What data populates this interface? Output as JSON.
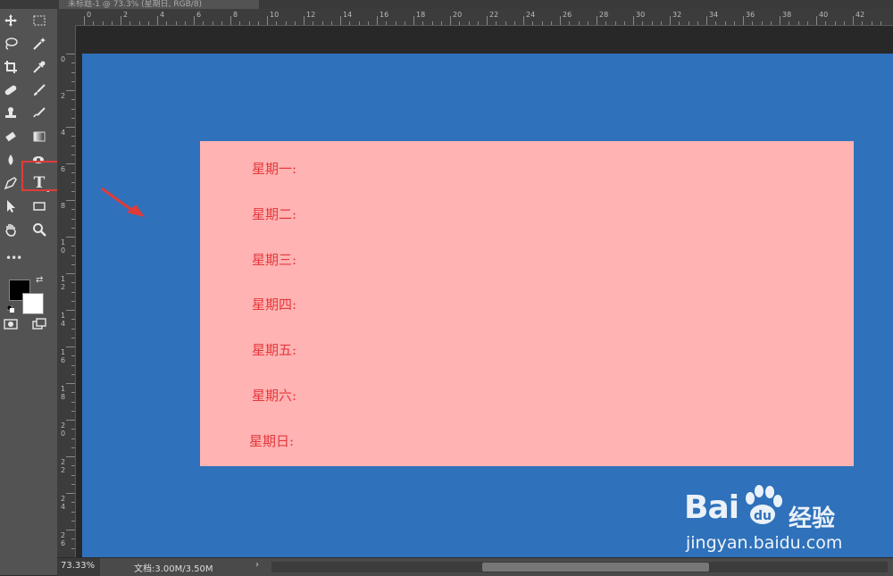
{
  "document_tab": {
    "title": "未标题-1 @ 73.3% (星期日, RGB/8)"
  },
  "toolbar": {
    "tools": [
      {
        "name": "move-tool",
        "icon": "move-icon"
      },
      {
        "name": "marquee-tool",
        "icon": "marquee-icon"
      },
      {
        "name": "lasso-tool",
        "icon": "lasso-icon"
      },
      {
        "name": "magic-wand-tool",
        "icon": "magic-wand-icon"
      },
      {
        "name": "crop-tool",
        "icon": "crop-icon"
      },
      {
        "name": "eyedropper-tool",
        "icon": "eyedropper-icon"
      },
      {
        "name": "healing-tool",
        "icon": "bandage-icon"
      },
      {
        "name": "brush-tool",
        "icon": "brush-icon"
      },
      {
        "name": "stamp-tool",
        "icon": "stamp-icon"
      },
      {
        "name": "history-brush-tool",
        "icon": "history-brush-icon"
      },
      {
        "name": "eraser-tool",
        "icon": "eraser-icon"
      },
      {
        "name": "gradient-tool",
        "icon": "gradient-icon"
      },
      {
        "name": "blur-tool",
        "icon": "drop-icon"
      },
      {
        "name": "dodge-tool",
        "icon": "dodge-icon"
      },
      {
        "name": "pen-tool",
        "icon": "pen-icon"
      },
      {
        "name": "type-tool",
        "icon": "type-icon",
        "label": "T"
      },
      {
        "name": "path-selection-tool",
        "icon": "arrow-icon"
      },
      {
        "name": "rectangle-tool",
        "icon": "rectangle-icon"
      },
      {
        "name": "hand-tool",
        "icon": "hand-icon"
      },
      {
        "name": "zoom-tool",
        "icon": "magnifier-icon"
      }
    ],
    "foreground_color": "#000000",
    "background_color": "#ffffff",
    "highlight_color": "#e03b3b"
  },
  "ruler_top": [
    "0",
    "2",
    "4",
    "6",
    "8",
    "10",
    "12",
    "14",
    "16",
    "18",
    "20",
    "22",
    "24",
    "26",
    "28",
    "30",
    "32",
    "34",
    "36",
    "38",
    "40",
    "42"
  ],
  "ruler_left": [
    "0",
    "2",
    "4",
    "6",
    "8",
    "10",
    "12",
    "14",
    "16",
    "18",
    "20",
    "22",
    "24",
    "26"
  ],
  "canvas": {
    "background_color": "#2f71ba",
    "box_color": "#ffb3b3",
    "text_color": "#e5383b",
    "days": [
      "星期一:",
      "星期二:",
      "星期三:",
      "星期四:",
      "星期五:",
      "星期六:",
      "星期日:"
    ]
  },
  "watermark": {
    "logo_left": "Bai",
    "logo_right": "经验",
    "url": "jingyan.baidu.com"
  },
  "statusbar": {
    "zoom": "73.33%",
    "doc_size": "文档:3.00M/3.50M",
    "arrow": "›"
  }
}
